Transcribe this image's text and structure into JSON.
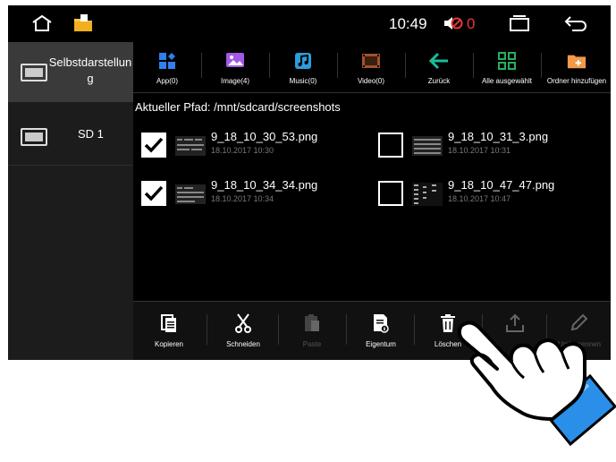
{
  "statusbar": {
    "time": "10:49",
    "mute_count": "0",
    "icons": [
      "home-icon",
      "folder-icon",
      "mute-icon",
      "recent-apps-icon",
      "back-arrow-icon"
    ]
  },
  "sidebar": {
    "items": [
      {
        "label": "Selbstdarstellun g",
        "icon": "tv-icon"
      },
      {
        "label": "SD 1",
        "icon": "tv-icon"
      }
    ]
  },
  "toolbar": {
    "items": [
      {
        "label": "App(0)",
        "icon": "app-grid-icon",
        "color": "#2f80ed"
      },
      {
        "label": "Image(4)",
        "icon": "image-icon",
        "color": "#a259e6"
      },
      {
        "label": "Music(0)",
        "icon": "music-note-icon",
        "color": "#2d9cdb"
      },
      {
        "label": "Video(0)",
        "icon": "film-icon",
        "color": "#a0522d"
      },
      {
        "label": "Zurück",
        "icon": "arrow-left-icon",
        "color": "#1abc9c"
      },
      {
        "label": "Alle ausgewählt",
        "icon": "select-all-icon",
        "color": "#27ae60"
      },
      {
        "label": "Ordner hinzufügen",
        "icon": "add-folder-icon",
        "color": "#f2994a"
      }
    ]
  },
  "path": {
    "text": "Aktueller Pfad: /mnt/sdcard/screenshots"
  },
  "files": [
    {
      "name": "9_18_10_30_53.png",
      "date": "18.10.2017 10:30",
      "checked": true
    },
    {
      "name": "9_18_10_31_3.png",
      "date": "18.10.2017 10:31",
      "checked": false
    },
    {
      "name": "9_18_10_34_34.png",
      "date": "18.10.2017 10:34",
      "checked": true
    },
    {
      "name": "9_18_10_47_47.png",
      "date": "18.10.2017 10:47",
      "checked": false
    }
  ],
  "bottombar": {
    "items": [
      {
        "label": "Kopieren",
        "icon": "copy-icon",
        "enabled": true
      },
      {
        "label": "Schneiden",
        "icon": "scissors-icon",
        "enabled": true
      },
      {
        "label": "Paste",
        "icon": "paste-icon",
        "enabled": false
      },
      {
        "label": "Eigentum",
        "icon": "properties-icon",
        "enabled": true
      },
      {
        "label": "Löschen",
        "icon": "trash-icon",
        "enabled": true
      },
      {
        "label": "",
        "icon": "share-icon",
        "enabled": false
      },
      {
        "label": "Umbenennen",
        "icon": "rename-pencil-icon",
        "enabled": false
      }
    ]
  },
  "overlay": {
    "icon": "pointing-hand-icon"
  }
}
